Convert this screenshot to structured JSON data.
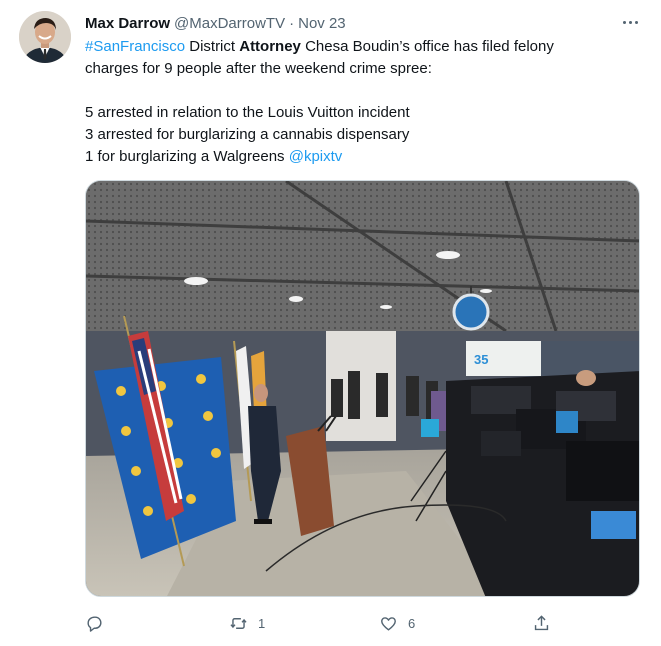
{
  "tweet": {
    "author_name": "Max Darrow",
    "handle": "@MaxDarrowTV",
    "separator": "·",
    "date": "Nov 23",
    "text": {
      "hashtag": "#SanFrancisco",
      "line1_a": " District ",
      "line1_bold": "Attorney",
      "line1_b": " Chesa Boudin’s office has filed felony",
      "line2": "charges for 9 people after the weekend crime spree:",
      "item1": "5 arrested in relation to the Louis Vuitton incident",
      "item2": "3 arrested for burglarizing a cannabis dispensary",
      "item3_prefix": "1 for burglarizing a Walgreens ",
      "mention": "@kpixtv"
    },
    "media": {
      "alt_icon": "press-conference-photo",
      "banner_text": "35"
    },
    "actions": {
      "reply_count": "",
      "retweet_count": "1",
      "like_count": "6",
      "share_count": ""
    }
  },
  "colors": {
    "link": "#1d9bf0",
    "secondary_text": "#536471",
    "primary_text": "#0f1419"
  },
  "icons": [
    "more-icon",
    "reply-icon",
    "retweet-icon",
    "like-icon",
    "share-icon"
  ]
}
